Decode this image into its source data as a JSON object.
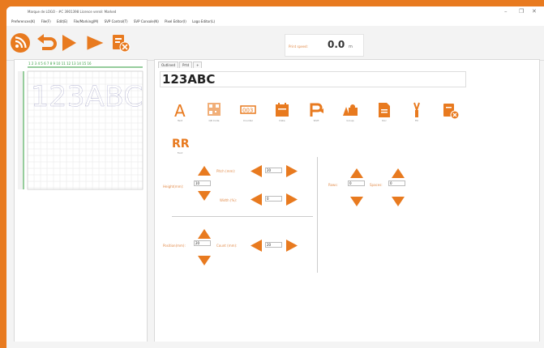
{
  "window": {
    "title": "Marque de LOGO - #C 3901398        Licence versé: Marked",
    "controls": [
      "–",
      "❐",
      "✕"
    ]
  },
  "menu": [
    "Preferences(K)",
    "File(F)",
    "Edit(E)",
    "File/Marking(M)",
    "SVP Control(T)",
    "SVP Console(N)",
    "Pixel Editor(I)",
    "Logo Editor(L)"
  ],
  "toolbar": {
    "buttons": [
      "rss-icon",
      "undo-icon",
      "play-icon",
      "run-icon",
      "export-icon"
    ],
    "speed": {
      "label": "Print speed:",
      "value": "0.0",
      "unit": "m"
    }
  },
  "preview": {
    "text": "123ABC",
    "ruler_numbers": "1 2 3 4 5 6 7 8 9 10 11 12 13 14 15 16"
  },
  "editor": {
    "tabs": [
      "Outlined",
      "Prtd",
      "+"
    ],
    "text_value": "123ABC",
    "tools": [
      {
        "name": "text-tool-icon",
        "label": "Text"
      },
      {
        "name": "qrcode-tool-icon",
        "label": "QR Code"
      },
      {
        "name": "counter-tool-icon",
        "label": "Counter"
      },
      {
        "name": "calendar-tool-icon",
        "label": "Date"
      },
      {
        "name": "shift-tool-icon",
        "label": "Shift"
      },
      {
        "name": "cards-tool-icon",
        "label": "Group"
      },
      {
        "name": "document-tool-icon",
        "label": "Doc"
      },
      {
        "name": "brush-tool-icon",
        "label": "Fill"
      },
      {
        "name": "export-tool-icon",
        "label": ""
      },
      {
        "name": "font-tool-icon",
        "label": "Font"
      }
    ],
    "params": {
      "height_label": "Height(mm):",
      "height_value": "10",
      "pitch_label": "Pitch (mm):",
      "pitch_value": "20",
      "width_label": "Width (%):",
      "width_value": "0",
      "position_label": "Position(mm):",
      "position_value": "20",
      "count_label": "Count (mm):",
      "count_value": "20",
      "rows_label": "Rows:",
      "rows_value": "0",
      "spaces_label": "Spaces:",
      "spaces_value": "0"
    }
  },
  "colors": {
    "brand": "#e87a1f",
    "accent": "#e28b4a"
  }
}
